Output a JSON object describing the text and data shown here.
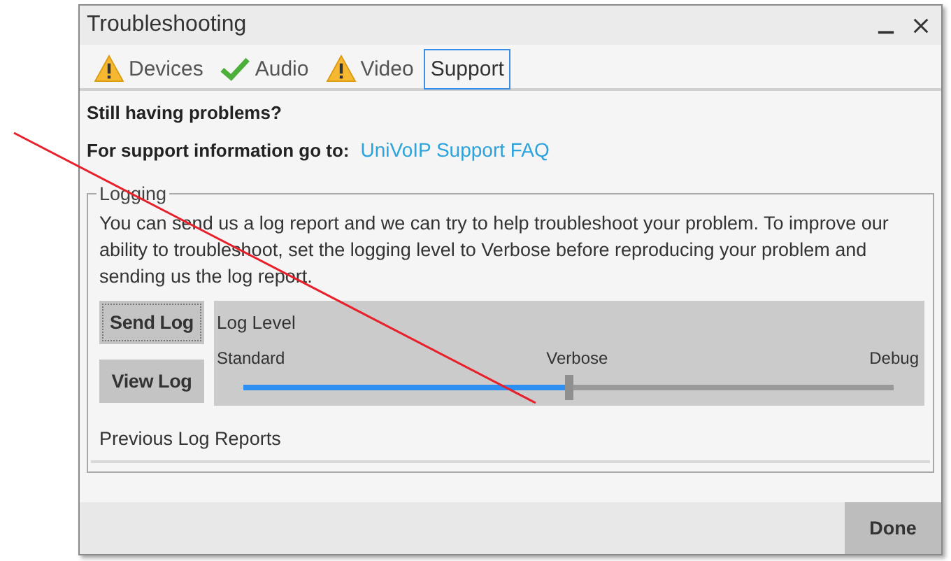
{
  "window": {
    "title": "Troubleshooting"
  },
  "tabs": [
    {
      "label": "Devices",
      "kind": "warning",
      "selected": false
    },
    {
      "label": "Audio",
      "kind": "ok",
      "selected": false
    },
    {
      "label": "Video",
      "kind": "warning",
      "selected": false
    },
    {
      "label": "Support",
      "kind": "plain",
      "selected": true
    }
  ],
  "heading": "Still having problems?",
  "support": {
    "label": "For support information go to:",
    "link": "UniVoIP Support FAQ"
  },
  "logging": {
    "legend": "Logging",
    "description": "You can send us a log report and we can try to help troubleshoot your problem. To improve our ability to troubleshoot, set the logging level to Verbose before reproducing your problem and sending us the log report.",
    "buttons": [
      {
        "label": "Send Log",
        "focused": true
      },
      {
        "label": "View Log",
        "focused": false
      }
    ],
    "log_level": {
      "title": "Log Level",
      "ticks": [
        "Standard",
        "Verbose",
        "Debug"
      ],
      "level": 0.5
    },
    "previous": "Previous Log Reports"
  },
  "footer": {
    "button": "Done"
  }
}
